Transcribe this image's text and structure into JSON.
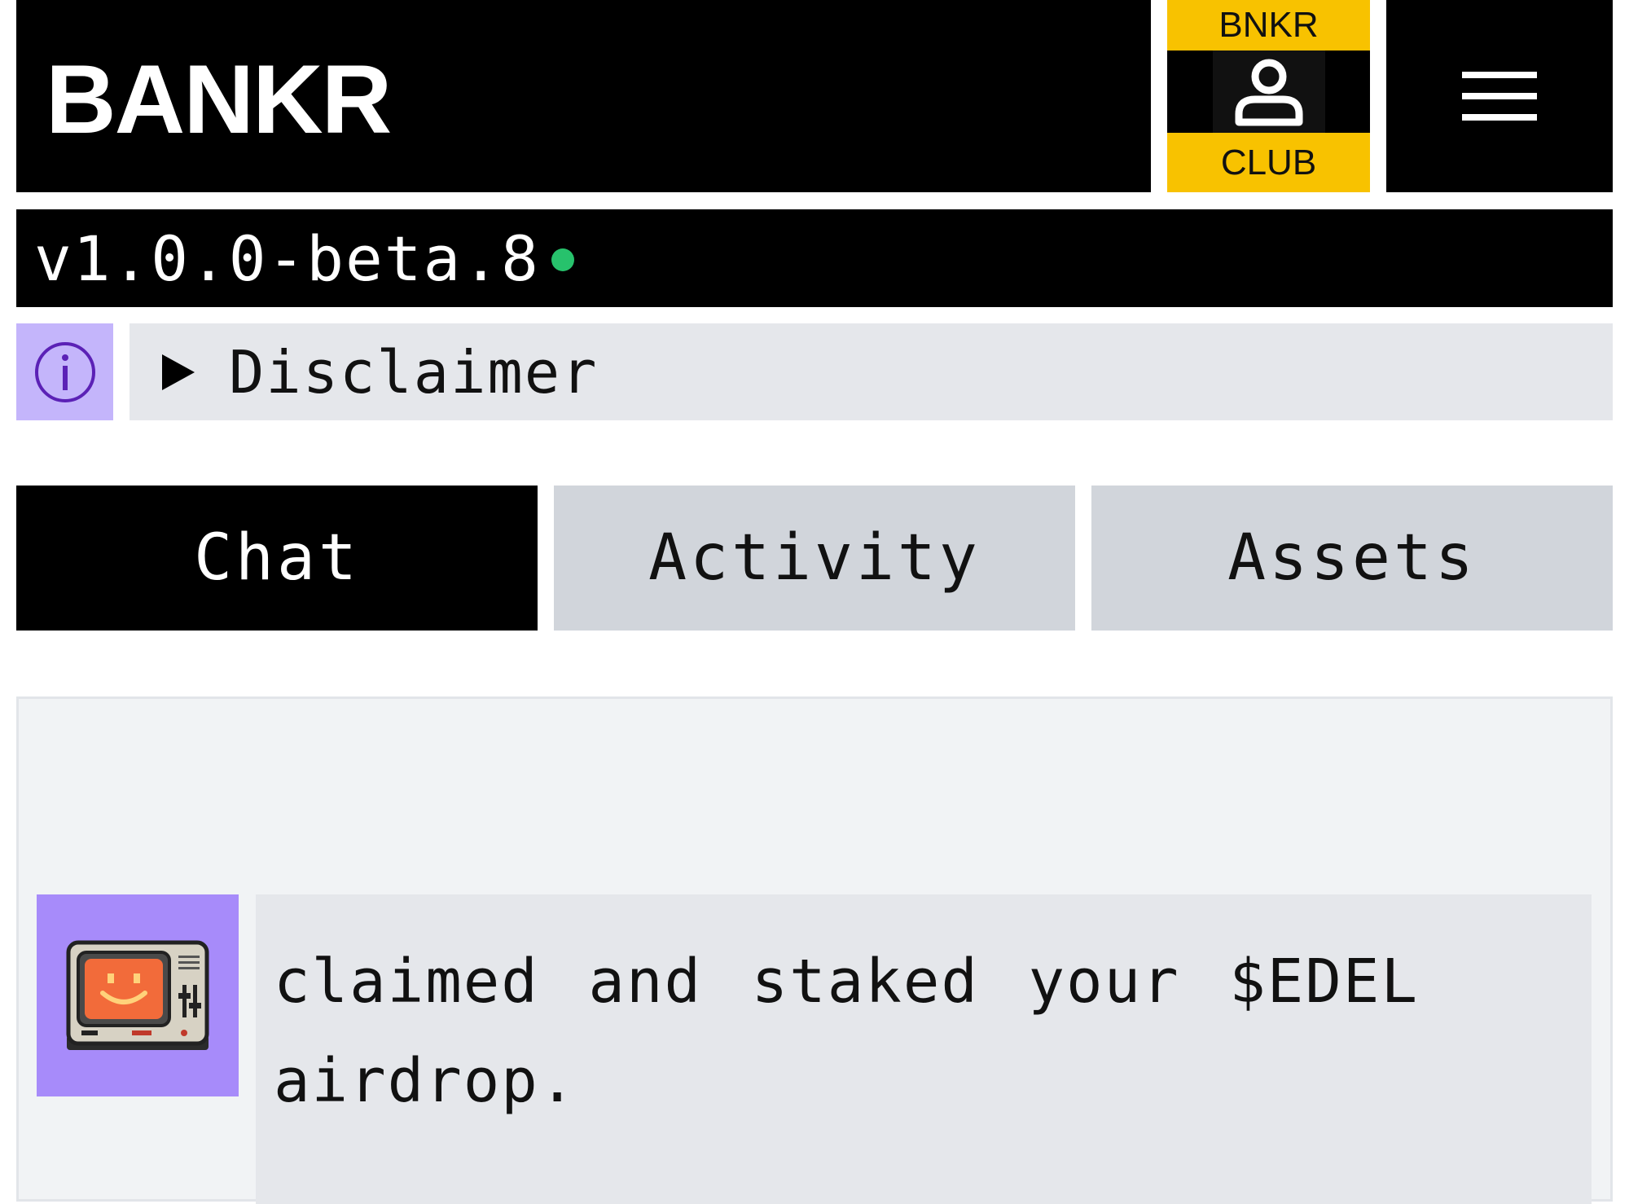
{
  "header": {
    "logo": "BANKR"
  },
  "club_badge": {
    "top_label": "BNKR",
    "bottom_label": "CLUB",
    "icon": "person-icon"
  },
  "menu": {
    "icon": "hamburger-menu-icon"
  },
  "version": {
    "text": "v1.0.0-beta.8",
    "status_color": "#27c26c"
  },
  "disclaimer": {
    "icon": "info-icon",
    "label": "Disclaimer"
  },
  "tabs": [
    {
      "label": "Chat",
      "active": true
    },
    {
      "label": "Activity",
      "active": false
    },
    {
      "label": "Assets",
      "active": false
    }
  ],
  "chat": {
    "messages": [
      {
        "avatar": "retro-computer-icon",
        "text": "claimed and staked your $EDEL airdrop."
      }
    ]
  },
  "colors": {
    "accent_yellow": "#f8c200",
    "accent_purple": "#a78bfa",
    "info_purple": "#c4b5fb"
  }
}
